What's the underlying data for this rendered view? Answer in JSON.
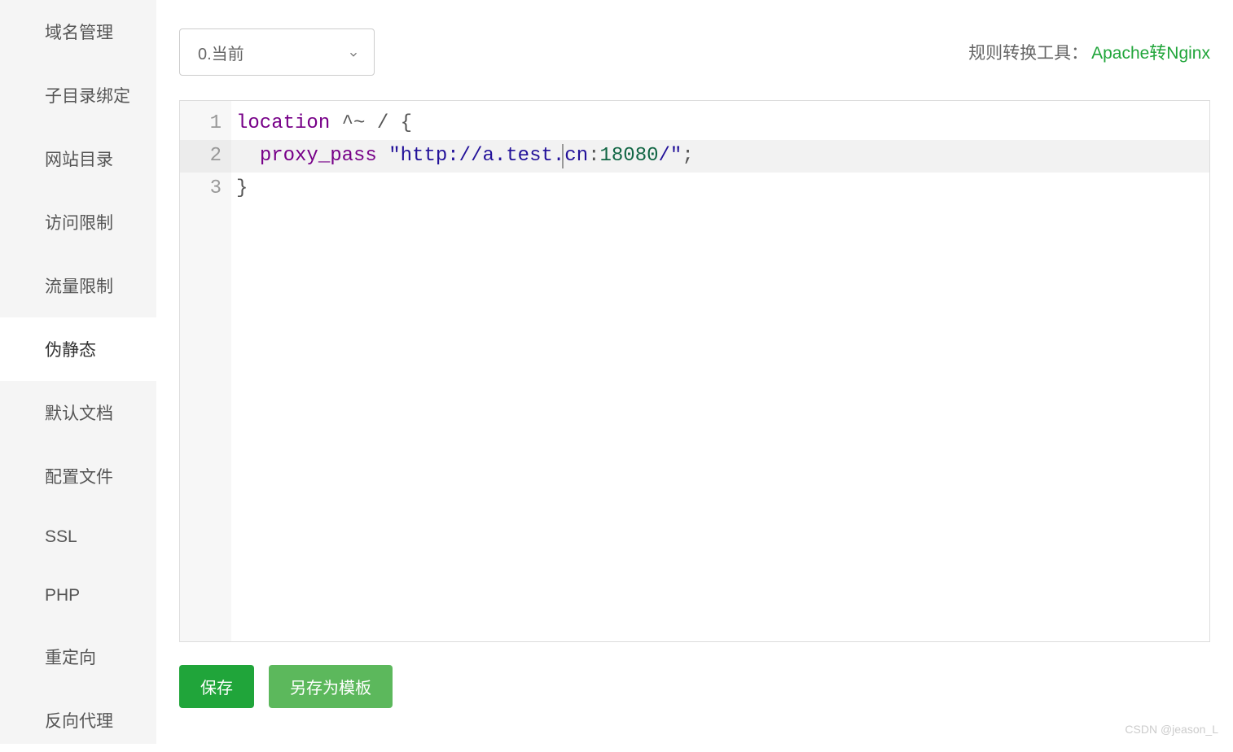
{
  "sidebar": {
    "items": [
      {
        "label": "域名管理",
        "key": "domain-mgmt"
      },
      {
        "label": "子目录绑定",
        "key": "subdir-bind"
      },
      {
        "label": "网站目录",
        "key": "site-dir"
      },
      {
        "label": "访问限制",
        "key": "access-limit"
      },
      {
        "label": "流量限制",
        "key": "traffic-limit"
      },
      {
        "label": "伪静态",
        "key": "pseudo-static"
      },
      {
        "label": "默认文档",
        "key": "default-doc"
      },
      {
        "label": "配置文件",
        "key": "config-file"
      },
      {
        "label": "SSL",
        "key": "ssl"
      },
      {
        "label": "PHP",
        "key": "php"
      },
      {
        "label": "重定向",
        "key": "redirect"
      },
      {
        "label": "反向代理",
        "key": "reverse-proxy"
      }
    ],
    "active_index": 5
  },
  "top": {
    "select_value": "0.当前",
    "tool_label": "规则转换工具：",
    "tool_link": "Apache转Nginx"
  },
  "editor": {
    "line_numbers": [
      "1",
      "2",
      "3"
    ],
    "active_line": 2,
    "code": {
      "line1": {
        "keyword": "location",
        "op": " ^~ / ",
        "brace": "{"
      },
      "line2": {
        "indent": "  ",
        "keyword": "proxy_pass",
        "space": " ",
        "quote1": "\"",
        "url_proto": "http://a.test.cn",
        "colon": ":",
        "port": "18080",
        "url_end": "/\"",
        "semi": ";"
      },
      "line3": {
        "brace": "}"
      }
    }
  },
  "buttons": {
    "save": "保存",
    "save_template": "另存为模板"
  },
  "watermark": "CSDN @jeason_L"
}
